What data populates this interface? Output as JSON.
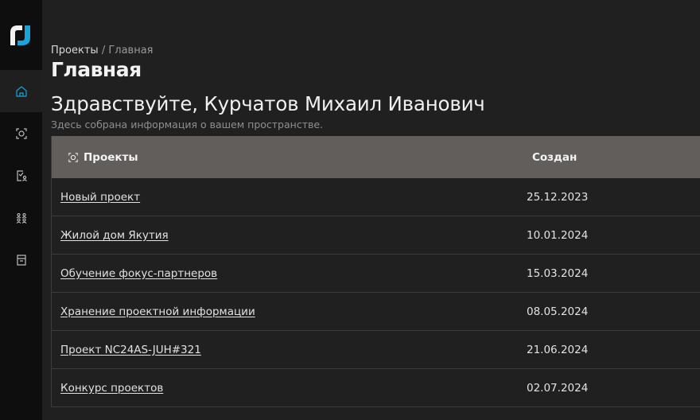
{
  "sidebar": {
    "logo": "logo-icon",
    "items": [
      {
        "icon": "home-icon",
        "active": true
      },
      {
        "icon": "projects-icon",
        "active": false
      },
      {
        "icon": "task-user-icon",
        "active": false
      },
      {
        "icon": "users-icon",
        "active": false
      },
      {
        "icon": "archive-icon",
        "active": false
      }
    ]
  },
  "header": {
    "breadcrumb_root": "Проекты",
    "breadcrumb_sep": "/",
    "breadcrumb_current": "Главная",
    "title": "Главная",
    "greeting": "Здравствуйте, Курчатов Михаил Иванович",
    "subtitle": "Здесь собрана информация о вашем пространстве."
  },
  "table": {
    "col_name": "Проекты",
    "col_date": "Создан",
    "rows": [
      {
        "name": "Новый проект",
        "date": "25.12.2023"
      },
      {
        "name": "Жилой дом Якутия",
        "date": "10.01.2024"
      },
      {
        "name": "Обучение фокус-партнеров",
        "date": "15.03.2024"
      },
      {
        "name": "Хранение проектной информации",
        "date": "08.05.2024"
      },
      {
        "name": "Проект NC24AS-JUH#321",
        "date": "21.06.2024"
      },
      {
        "name": "Конкурс проектов",
        "date": "02.07.2024"
      }
    ]
  },
  "colors": {
    "accent": "#1aa3d9",
    "header_bg": "#625e5c",
    "sidebar_bg": "#0e0e0e",
    "page_bg": "#202020"
  }
}
